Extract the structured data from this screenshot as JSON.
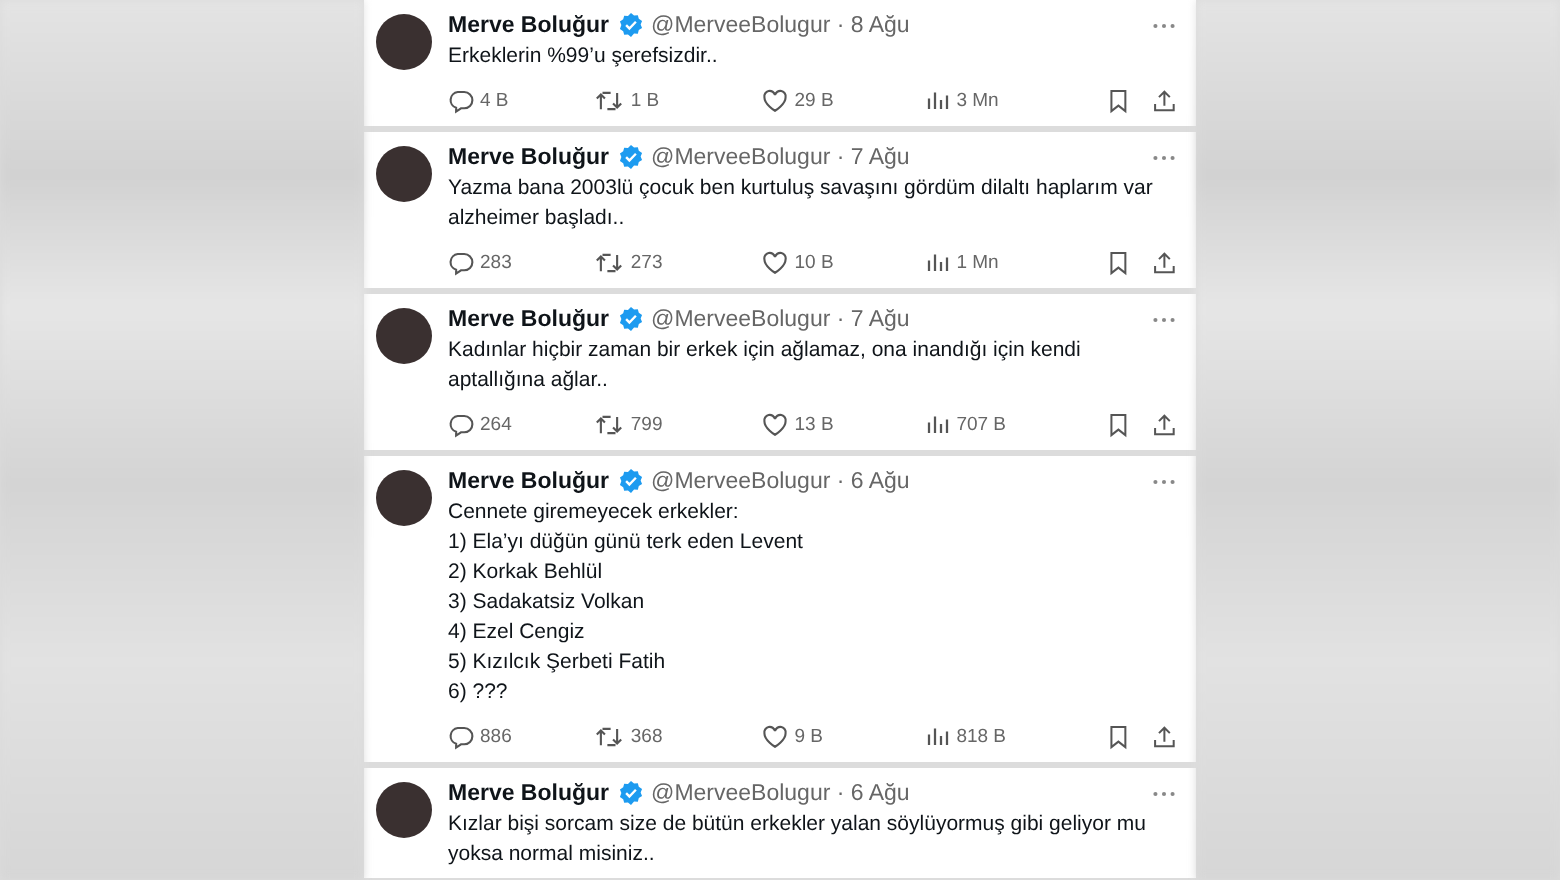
{
  "tweets": [
    {
      "name": "Merve Boluğur",
      "verified": true,
      "meta": "@MerveeBolugur · 8 Ağu",
      "text": "Erkeklerin %99’u şerefsizdir..",
      "stats": {
        "replies": "4 B",
        "retweets": "1 B",
        "likes": "29 B",
        "views": "3 Mn"
      }
    },
    {
      "name": "Merve Boluğur",
      "verified": true,
      "meta": "@MerveeBolugur · 7 Ağu",
      "text": "Yazma bana 2003lü çocuk ben kurtuluş savaşını gördüm dilaltı haplarım var alzheimer başladı..",
      "stats": {
        "replies": "283",
        "retweets": "273",
        "likes": "10 B",
        "views": "1 Mn"
      }
    },
    {
      "name": "Merve Boluğur",
      "verified": true,
      "meta": "@MerveeBolugur · 7 Ağu",
      "text": "Kadınlar hiçbir zaman bir erkek için ağlamaz, ona inandığı için kendi aptallığına ağlar..",
      "stats": {
        "replies": "264",
        "retweets": "799",
        "likes": "13 B",
        "views": "707 B"
      }
    },
    {
      "name": "Merve Boluğur",
      "verified": true,
      "meta": "@MerveeBolugur · 6 Ağu",
      "text": "Cennete giremeyecek erkekler:\n1) Ela’yı düğün günü terk eden Levent\n2) Korkak Behlül\n3) Sadakatsiz Volkan\n4) Ezel Cengiz\n5) Kızılcık Şerbeti Fatih\n6) ???",
      "stats": {
        "replies": "886",
        "retweets": "368",
        "likes": "9 B",
        "views": "818 B"
      }
    },
    {
      "name": "Merve Boluğur",
      "verified": true,
      "meta": "@MerveeBolugur · 6 Ağu",
      "text": "Kızlar bişi sorcam size de bütün erkekler yalan söylüyormuş gibi geliyor mu yoksa normal misiniz.."
    }
  ]
}
